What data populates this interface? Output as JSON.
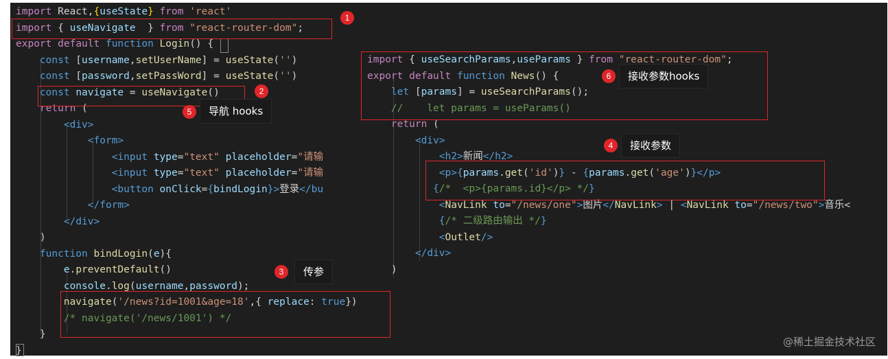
{
  "left_code": [
    [
      [
        "kw2",
        "import"
      ],
      [
        "plain",
        " React,"
      ],
      [
        "brk",
        "{"
      ],
      [
        "var",
        "useState"
      ],
      [
        "brk",
        "}"
      ],
      [
        "plain",
        " "
      ],
      [
        "kw2",
        "from"
      ],
      [
        "plain",
        " "
      ],
      [
        "str",
        "'react'"
      ]
    ],
    [
      [
        "kw2",
        "import"
      ],
      [
        "plain",
        " { "
      ],
      [
        "var",
        "useNavigate"
      ],
      [
        "plain",
        "  } "
      ],
      [
        "kw2",
        "from"
      ],
      [
        "plain",
        " "
      ],
      [
        "str",
        "\"react-router-dom\""
      ],
      [
        "plain",
        ";"
      ]
    ],
    [
      [
        "kw2",
        "export"
      ],
      [
        "plain",
        " "
      ],
      [
        "kw2",
        "default"
      ],
      [
        "plain",
        " "
      ],
      [
        "kw",
        "function"
      ],
      [
        "plain",
        " "
      ],
      [
        "fn",
        "Login"
      ],
      [
        "plain",
        "() {"
      ]
    ],
    [
      [
        "plain",
        "    "
      ],
      [
        "kw",
        "const"
      ],
      [
        "plain",
        " ["
      ],
      [
        "var",
        "username"
      ],
      [
        "plain",
        ","
      ],
      [
        "fn",
        "setUserName"
      ],
      [
        "plain",
        "] = "
      ],
      [
        "fn",
        "useState"
      ],
      [
        "plain",
        "("
      ],
      [
        "str",
        "''"
      ],
      [
        "plain",
        ")"
      ]
    ],
    [
      [
        "plain",
        "    "
      ],
      [
        "kw",
        "const"
      ],
      [
        "plain",
        " ["
      ],
      [
        "var",
        "password"
      ],
      [
        "plain",
        ","
      ],
      [
        "fn",
        "setPassWord"
      ],
      [
        "plain",
        "] = "
      ],
      [
        "fn",
        "useState"
      ],
      [
        "plain",
        "("
      ],
      [
        "str",
        "''"
      ],
      [
        "plain",
        ")"
      ]
    ],
    [
      [
        "plain",
        "    "
      ],
      [
        "kw",
        "const"
      ],
      [
        "plain",
        " "
      ],
      [
        "var",
        "navigate"
      ],
      [
        "plain",
        " = "
      ],
      [
        "fn",
        "useNavigate"
      ],
      [
        "plain",
        "()"
      ]
    ],
    [
      [
        "plain",
        "    "
      ],
      [
        "kw2",
        "return"
      ],
      [
        "plain",
        " ("
      ]
    ],
    [
      [
        "plain",
        "        "
      ],
      [
        "tag",
        "<"
      ],
      [
        "tagn",
        "div"
      ],
      [
        "tag",
        ">"
      ]
    ],
    [
      [
        "plain",
        "            "
      ],
      [
        "tag",
        "<"
      ],
      [
        "tagn",
        "form"
      ],
      [
        "tag",
        ">"
      ]
    ],
    [
      [
        "plain",
        "                "
      ],
      [
        "tag",
        "<"
      ],
      [
        "tagn",
        "input"
      ],
      [
        "plain",
        " "
      ],
      [
        "attr",
        "type"
      ],
      [
        "plain",
        "="
      ],
      [
        "str",
        "\"text\""
      ],
      [
        "plain",
        " "
      ],
      [
        "attr",
        "placeholder"
      ],
      [
        "plain",
        "="
      ],
      [
        "str",
        "\"请输"
      ]
    ],
    [
      [
        "plain",
        "                "
      ],
      [
        "tag",
        "<"
      ],
      [
        "tagn",
        "input"
      ],
      [
        "plain",
        " "
      ],
      [
        "attr",
        "type"
      ],
      [
        "plain",
        "="
      ],
      [
        "str",
        "\"text\""
      ],
      [
        "plain",
        " "
      ],
      [
        "attr",
        "placeholder"
      ],
      [
        "plain",
        "="
      ],
      [
        "str",
        "\"请输"
      ]
    ],
    [
      [
        "plain",
        "                "
      ],
      [
        "tag",
        "<"
      ],
      [
        "tagn",
        "button"
      ],
      [
        "plain",
        " "
      ],
      [
        "attr",
        "onClick"
      ],
      [
        "plain",
        "="
      ],
      [
        "kw",
        "{"
      ],
      [
        "var",
        "bindLogin"
      ],
      [
        "kw",
        "}"
      ],
      [
        "tag",
        ">"
      ],
      [
        "plain",
        "登录"
      ],
      [
        "tag",
        "</"
      ],
      [
        "tagn",
        "bu"
      ]
    ],
    [
      [
        "plain",
        "            "
      ],
      [
        "tag",
        "</"
      ],
      [
        "tagn",
        "form"
      ],
      [
        "tag",
        ">"
      ]
    ],
    [
      [
        "plain",
        "        "
      ],
      [
        "tag",
        "</"
      ],
      [
        "tagn",
        "div"
      ],
      [
        "tag",
        ">"
      ]
    ],
    [
      [
        "plain",
        "    )"
      ]
    ],
    [
      [
        "plain",
        "    "
      ],
      [
        "kw",
        "function"
      ],
      [
        "plain",
        " "
      ],
      [
        "fn",
        "bindLogin"
      ],
      [
        "plain",
        "("
      ],
      [
        "var",
        "e"
      ],
      [
        "plain",
        "){"
      ]
    ],
    [
      [
        "plain",
        "        "
      ],
      [
        "var",
        "e"
      ],
      [
        "plain",
        "."
      ],
      [
        "fn",
        "preventDefault"
      ],
      [
        "plain",
        "()"
      ]
    ],
    [
      [
        "plain",
        "        "
      ],
      [
        "var",
        "console"
      ],
      [
        "plain",
        "."
      ],
      [
        "fn",
        "log"
      ],
      [
        "plain",
        "("
      ],
      [
        "var",
        "username"
      ],
      [
        "plain",
        ","
      ],
      [
        "var",
        "password"
      ],
      [
        "plain",
        ");"
      ]
    ],
    [
      [
        "plain",
        "        "
      ],
      [
        "fn",
        "navigate"
      ],
      [
        "plain",
        "("
      ],
      [
        "str",
        "'/news?id=1001&age=18'"
      ],
      [
        "plain",
        ",{ "
      ],
      [
        "var",
        "replace"
      ],
      [
        "plain",
        ": "
      ],
      [
        "kw",
        "true"
      ],
      [
        "plain",
        "})"
      ]
    ],
    [
      [
        "plain",
        "        "
      ],
      [
        "cmt",
        "/* navigate('/news/1001') */"
      ]
    ],
    [
      [
        "plain",
        "    }"
      ]
    ],
    [
      [
        "plain",
        "}"
      ]
    ]
  ],
  "right_code": [
    [
      [
        "kw2",
        "import"
      ],
      [
        "plain",
        " { "
      ],
      [
        "var",
        "useSearchParams"
      ],
      [
        "plain",
        ","
      ],
      [
        "var",
        "useParams"
      ],
      [
        "plain",
        " } "
      ],
      [
        "kw2",
        "from"
      ],
      [
        "plain",
        " "
      ],
      [
        "str",
        "\"react-router-dom\""
      ],
      [
        "plain",
        ";"
      ]
    ],
    [
      [
        "kw2",
        "export"
      ],
      [
        "plain",
        " "
      ],
      [
        "kw2",
        "default"
      ],
      [
        "plain",
        " "
      ],
      [
        "kw",
        "function"
      ],
      [
        "plain",
        " "
      ],
      [
        "fn",
        "News"
      ],
      [
        "plain",
        "() {"
      ]
    ],
    [
      [
        "plain",
        "    "
      ],
      [
        "kw",
        "let"
      ],
      [
        "plain",
        " ["
      ],
      [
        "var",
        "params"
      ],
      [
        "plain",
        "] = "
      ],
      [
        "fn",
        "useSearchParams"
      ],
      [
        "plain",
        "();"
      ]
    ],
    [
      [
        "plain",
        "    "
      ],
      [
        "cmt",
        "//    let params = useParams()"
      ]
    ],
    [
      [
        "plain",
        "    "
      ],
      [
        "kw2",
        "return"
      ],
      [
        "plain",
        " ("
      ]
    ],
    [
      [
        "plain",
        "        "
      ],
      [
        "tag",
        "<"
      ],
      [
        "tagn",
        "div"
      ],
      [
        "tag",
        ">"
      ]
    ],
    [
      [
        "plain",
        "            "
      ],
      [
        "tag",
        "<"
      ],
      [
        "tagn",
        "h2"
      ],
      [
        "tag",
        ">"
      ],
      [
        "plain",
        "新闻"
      ],
      [
        "tag",
        "</"
      ],
      [
        "tagn",
        "h2"
      ],
      [
        "tag",
        ">"
      ]
    ],
    [
      [
        "plain",
        "            "
      ],
      [
        "tag",
        "<"
      ],
      [
        "tagn",
        "p"
      ],
      [
        "tag",
        ">"
      ],
      [
        "kw",
        "{"
      ],
      [
        "var",
        "params"
      ],
      [
        "plain",
        "."
      ],
      [
        "fn",
        "get"
      ],
      [
        "plain",
        "("
      ],
      [
        "str",
        "'id'"
      ],
      [
        "plain",
        ")"
      ],
      [
        "kw",
        "}"
      ],
      [
        "plain",
        " - "
      ],
      [
        "kw",
        "{"
      ],
      [
        "var",
        "params"
      ],
      [
        "plain",
        "."
      ],
      [
        "fn",
        "get"
      ],
      [
        "plain",
        "("
      ],
      [
        "str",
        "'age'"
      ],
      [
        "plain",
        ")"
      ],
      [
        "kw",
        "}"
      ],
      [
        "tag",
        "</"
      ],
      [
        "tagn",
        "p"
      ],
      [
        "tag",
        ">"
      ]
    ],
    [
      [
        "plain",
        "           "
      ],
      [
        "kw",
        "{"
      ],
      [
        "cmt",
        "/*  <p>{params.id}</p> */"
      ],
      [
        "kw",
        "}"
      ]
    ],
    [
      [
        "plain",
        "            "
      ],
      [
        "tag",
        "<"
      ],
      [
        "fn",
        "NavLink"
      ],
      [
        "plain",
        " "
      ],
      [
        "attr",
        "to"
      ],
      [
        "plain",
        "="
      ],
      [
        "str",
        "\"/news/one\""
      ],
      [
        "tag",
        ">"
      ],
      [
        "plain",
        "图片"
      ],
      [
        "tag",
        "</"
      ],
      [
        "fn",
        "NavLink"
      ],
      [
        "tag",
        ">"
      ],
      [
        "plain",
        " | "
      ],
      [
        "tag",
        "<"
      ],
      [
        "fn",
        "NavLink"
      ],
      [
        "plain",
        " "
      ],
      [
        "attr",
        "to"
      ],
      [
        "plain",
        "="
      ],
      [
        "str",
        "\"/news/two\""
      ],
      [
        "tag",
        ">"
      ],
      [
        "plain",
        "音乐<"
      ]
    ],
    [
      [
        "plain",
        "            "
      ],
      [
        "kw",
        "{"
      ],
      [
        "cmt",
        "/* 二级路由输出 */"
      ],
      [
        "kw",
        "}"
      ]
    ],
    [
      [
        "plain",
        "            "
      ],
      [
        "tag",
        "<"
      ],
      [
        "fn",
        "Outlet"
      ],
      [
        "tag",
        "/>"
      ]
    ],
    [
      [
        "plain",
        "        "
      ],
      [
        "tag",
        "</"
      ],
      [
        "tagn",
        "div"
      ],
      [
        "tag",
        ">"
      ]
    ],
    [
      [
        "plain",
        "    )"
      ]
    ]
  ],
  "annotations": {
    "badge1": "1",
    "badge2": "2",
    "badge3": "3",
    "badge4": "4",
    "badge5": "5",
    "badge6": "6",
    "tip3": "传参",
    "tip4": "接收参数",
    "tip5": "导航 hooks",
    "tip6": "接收参数hooks"
  },
  "watermark": "@稀土掘金技术社区"
}
